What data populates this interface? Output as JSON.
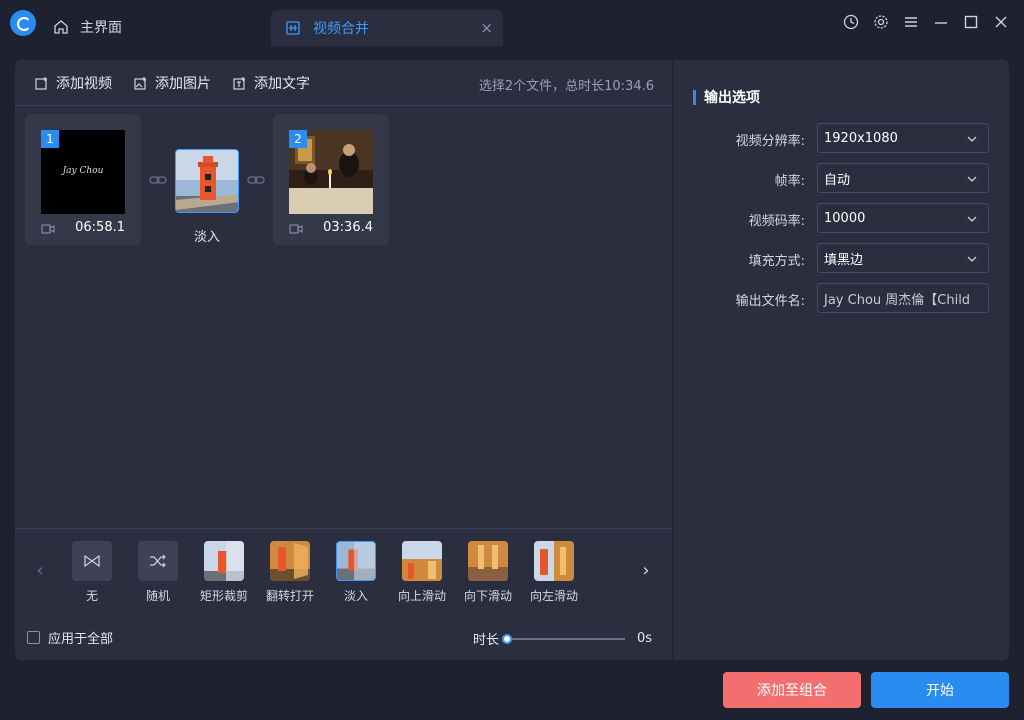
{
  "titlebar": {
    "home_tab": "主界面",
    "active_tab": "视频合并",
    "close_glyph": "×"
  },
  "toolbar": {
    "add_video": "添加视频",
    "add_image": "添加图片",
    "add_text": "添加文字",
    "summary": "选择2个文件，总时长10:34.6"
  },
  "clips": [
    {
      "number": "1",
      "duration": "06:58.1",
      "thumb_text": "Jay Chou"
    },
    {
      "number": "2",
      "duration": "03:36.4"
    }
  ],
  "transition": {
    "label": "淡入"
  },
  "effects": [
    {
      "label": "无",
      "icon": "bowtie-icon"
    },
    {
      "label": "随机",
      "icon": "shuffle-icon"
    },
    {
      "label": "矩形裁剪"
    },
    {
      "label": "翻转打开"
    },
    {
      "label": "淡入",
      "selected": true
    },
    {
      "label": "向上滑动"
    },
    {
      "label": "向下滑动"
    },
    {
      "label": "向左滑动"
    }
  ],
  "nav": {
    "prev": "‹",
    "next": "›"
  },
  "apply_all": "应用于全部",
  "duration": {
    "label": "时长",
    "value": "0s",
    "level": 0
  },
  "output": {
    "title": "输出选项",
    "resolution_label": "视频分辨率:",
    "resolution_value": "1920x1080",
    "fps_label": "帧率:",
    "fps_value": "自动",
    "bitrate_label": "视频码率:",
    "bitrate_value": "10000",
    "fill_label": "填充方式:",
    "fill_value": "填黑边",
    "filename_label": "输出文件名:",
    "filename_value": "Jay Chou 周杰倫【Child"
  },
  "buttons": {
    "add_to_combo": "添加至组合",
    "start": "开始"
  },
  "colors": {
    "accent": "#2a8cf0",
    "danger": "#f36f6f",
    "panel": "#2a2e3f",
    "background": "#1e2130"
  }
}
